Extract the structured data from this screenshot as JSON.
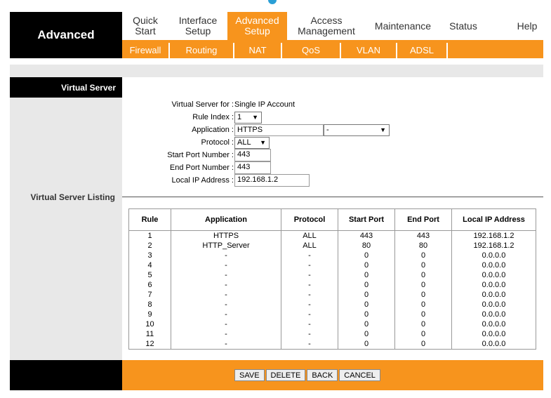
{
  "header": {
    "brand": "Advanced",
    "nav": [
      {
        "label": "Quick\nStart",
        "active": false
      },
      {
        "label": "Interface\nSetup",
        "active": false
      },
      {
        "label": "Advanced\nSetup",
        "active": true
      },
      {
        "label": "Access\nManagement",
        "active": false
      },
      {
        "label": "Maintenance",
        "active": false
      },
      {
        "label": "Status",
        "active": false
      },
      {
        "label": "Help",
        "active": false
      }
    ],
    "subnav": [
      "Firewall",
      "Routing",
      "NAT",
      "QoS",
      "VLAN",
      "ADSL"
    ]
  },
  "section": {
    "title": "Virtual Server",
    "listing_title": "Virtual Server Listing"
  },
  "form": {
    "virtual_server_for_label": "Virtual Server for :",
    "virtual_server_for_value": "Single IP Account",
    "rule_index_label": "Rule Index :",
    "rule_index_value": "1",
    "application_label": "Application :",
    "application_value": "HTTPS",
    "application_select_value": "-",
    "protocol_label": "Protocol :",
    "protocol_value": "ALL",
    "start_port_label": "Start Port Number :",
    "start_port_value": "443",
    "end_port_label": "End Port Number :",
    "end_port_value": "443",
    "local_ip_label": "Local IP Address :",
    "local_ip_value": "192.168.1.2"
  },
  "table": {
    "columns": [
      "Rule",
      "Application",
      "Protocol",
      "Start Port",
      "End Port",
      "Local IP Address"
    ],
    "rows": [
      [
        "1",
        "HTTPS",
        "ALL",
        "443",
        "443",
        "192.168.1.2"
      ],
      [
        "2",
        "HTTP_Server",
        "ALL",
        "80",
        "80",
        "192.168.1.2"
      ],
      [
        "3",
        "-",
        "-",
        "0",
        "0",
        "0.0.0.0"
      ],
      [
        "4",
        "-",
        "-",
        "0",
        "0",
        "0.0.0.0"
      ],
      [
        "5",
        "-",
        "-",
        "0",
        "0",
        "0.0.0.0"
      ],
      [
        "6",
        "-",
        "-",
        "0",
        "0",
        "0.0.0.0"
      ],
      [
        "7",
        "-",
        "-",
        "0",
        "0",
        "0.0.0.0"
      ],
      [
        "8",
        "-",
        "-",
        "0",
        "0",
        "0.0.0.0"
      ],
      [
        "9",
        "-",
        "-",
        "0",
        "0",
        "0.0.0.0"
      ],
      [
        "10",
        "-",
        "-",
        "0",
        "0",
        "0.0.0.0"
      ],
      [
        "11",
        "-",
        "-",
        "0",
        "0",
        "0.0.0.0"
      ],
      [
        "12",
        "-",
        "-",
        "0",
        "0",
        "0.0.0.0"
      ]
    ]
  },
  "footer": {
    "save": "SAVE",
    "delete": "DELETE",
    "back": "BACK",
    "cancel": "CANCEL"
  },
  "colors": {
    "accent": "#f7941d",
    "dark": "#000000",
    "panel": "#e8e8e8"
  }
}
